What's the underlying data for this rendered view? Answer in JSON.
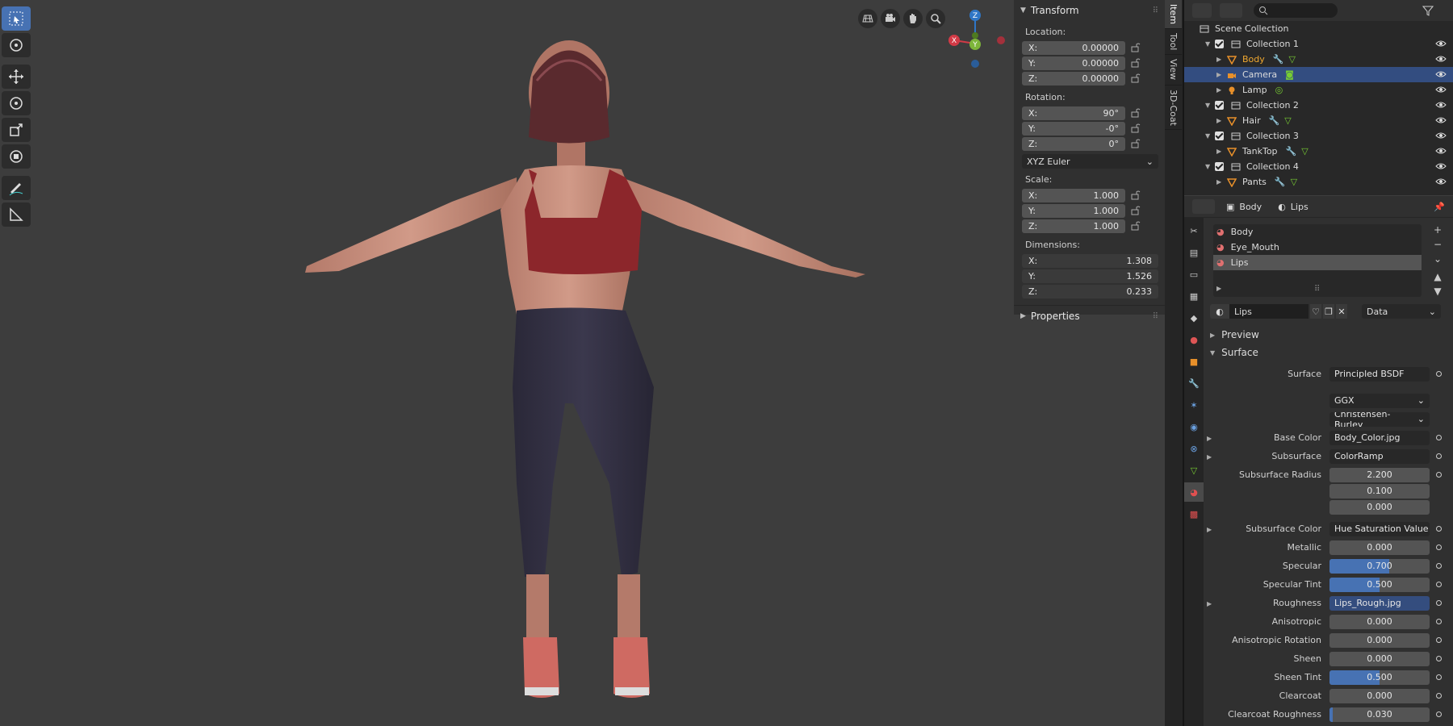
{
  "nav": {
    "z": "Z",
    "y": "Y",
    "x": "X"
  },
  "transform": {
    "title": "Transform",
    "location_label": "Location:",
    "location": [
      {
        "axis": "X:",
        "value": "0.00000"
      },
      {
        "axis": "Y:",
        "value": "0.00000"
      },
      {
        "axis": "Z:",
        "value": "0.00000"
      }
    ],
    "rotation_label": "Rotation:",
    "rotation": [
      {
        "axis": "X:",
        "value": "90°"
      },
      {
        "axis": "Y:",
        "value": "-0°"
      },
      {
        "axis": "Z:",
        "value": "0°"
      }
    ],
    "rotation_mode": "XYZ Euler",
    "scale_label": "Scale:",
    "scale": [
      {
        "axis": "X:",
        "value": "1.000"
      },
      {
        "axis": "Y:",
        "value": "1.000"
      },
      {
        "axis": "Z:",
        "value": "1.000"
      }
    ],
    "dimensions_label": "Dimensions:",
    "dimensions": [
      {
        "axis": "X:",
        "value": "1.308"
      },
      {
        "axis": "Y:",
        "value": "1.526"
      },
      {
        "axis": "Z:",
        "value": "0.233"
      }
    ]
  },
  "properties_panel": {
    "title": "Properties"
  },
  "side_tabs": [
    "Item",
    "Tool",
    "View",
    "3D-Coat"
  ],
  "outliner": {
    "scene": "Scene Collection",
    "rows": [
      {
        "label": "Collection 1",
        "type": "collection",
        "selected": false
      },
      {
        "label": "Body",
        "type": "mesh",
        "selected": false,
        "active": true
      },
      {
        "label": "Camera",
        "type": "camera",
        "selected": true
      },
      {
        "label": "Lamp",
        "type": "light",
        "selected": false
      },
      {
        "label": "Collection 2",
        "type": "collection",
        "selected": false
      },
      {
        "label": "Hair",
        "type": "mesh",
        "selected": false
      },
      {
        "label": "Collection 3",
        "type": "collection",
        "selected": false
      },
      {
        "label": "TankTop",
        "type": "mesh",
        "selected": false
      },
      {
        "label": "Collection 4",
        "type": "collection",
        "selected": false
      },
      {
        "label": "Pants",
        "type": "mesh",
        "selected": false
      }
    ]
  },
  "props": {
    "breadcrumb_object": "Body",
    "breadcrumb_material": "Lips",
    "slots": [
      "Body",
      "Eye_Mouth",
      "Lips"
    ],
    "material_name": "Lips",
    "link_mode": "Data",
    "preview_label": "Preview",
    "surface_section": "Surface",
    "surface_label": "Surface",
    "surface_value": "Principled BSDF",
    "distribution": "GGX",
    "subsurface_method": "Christensen-Burley",
    "rows": [
      {
        "label": "Base Color",
        "value": "Body_Color.jpg",
        "kind": "link",
        "expand": true
      },
      {
        "label": "Subsurface",
        "value": "ColorRamp",
        "kind": "link",
        "expand": true
      }
    ],
    "subsurface_radius_label": "Subsurface Radius",
    "subsurface_radius": [
      "2.200",
      "0.100",
      "0.000"
    ],
    "rows2": [
      {
        "label": "Subsurface Color",
        "value": "Hue Saturation Value",
        "kind": "link",
        "expand": true
      },
      {
        "label": "Metallic",
        "value": "0.000",
        "kind": "num",
        "fill": 0
      },
      {
        "label": "Specular",
        "value": "0.700",
        "kind": "num",
        "fill": 0.6
      },
      {
        "label": "Specular Tint",
        "value": "0.500",
        "kind": "num",
        "fill": 0.5
      },
      {
        "label": "Roughness",
        "value": "Lips_Rough.jpg",
        "kind": "sel",
        "expand": true
      },
      {
        "label": "Anisotropic",
        "value": "0.000",
        "kind": "num",
        "fill": 0
      },
      {
        "label": "Anisotropic Rotation",
        "value": "0.000",
        "kind": "num",
        "fill": 0
      },
      {
        "label": "Sheen",
        "value": "0.000",
        "kind": "num",
        "fill": 0
      },
      {
        "label": "Sheen Tint",
        "value": "0.500",
        "kind": "num",
        "fill": 0.5
      },
      {
        "label": "Clearcoat",
        "value": "0.000",
        "kind": "num",
        "fill": 0
      },
      {
        "label": "Clearcoat Roughness",
        "value": "0.030",
        "kind": "num",
        "fill": 0.03
      }
    ]
  }
}
